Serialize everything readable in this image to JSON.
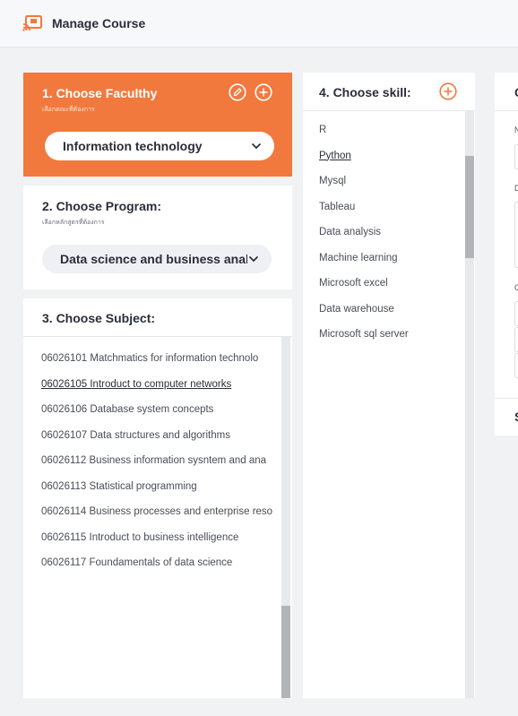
{
  "app": {
    "title": "Manage Course",
    "logo_icon": "course-logo-icon",
    "accent": "#f2793e"
  },
  "faculty": {
    "title": "1. Choose Faculthy",
    "subtitle": "เลือกคณะที่ต้องการ",
    "selected": "Information technology",
    "edit_icon": "edit-icon",
    "add_icon": "add-icon"
  },
  "program": {
    "title": "2. Choose Program:",
    "subtitle": "เลือกหลักสูตรที่ต้องการ",
    "selected": "Data science and business anal"
  },
  "subject": {
    "title": "3. Choose Subject:",
    "items": [
      "06026101 Matchmatics for information technolo",
      "06026105 Introduct to computer networks",
      "06026106 Database system concepts",
      "06026107 Data structures and algorithms",
      "06026112 Business information sysntem and ana",
      "06026113 Statistical programming",
      "06026114 Business processes and enterprise reso",
      "06026115 Introduct to business intelligence",
      "06026117 Foundamentals of data science"
    ],
    "selected_index": 1
  },
  "skill": {
    "title": "4. Choose skill:",
    "add_icon": "add-icon",
    "items": [
      "R",
      "Python",
      "Mysql",
      "Tableau",
      "Data analysis",
      "Machine learning",
      "Microsoft excel",
      "Data warehouse",
      "Microsoft sql server"
    ],
    "selected_index": 1
  },
  "right_panel": {
    "title_letter": "C",
    "label_1": "N",
    "label_2": "D",
    "label_3": "C",
    "footer_letter": "S"
  }
}
